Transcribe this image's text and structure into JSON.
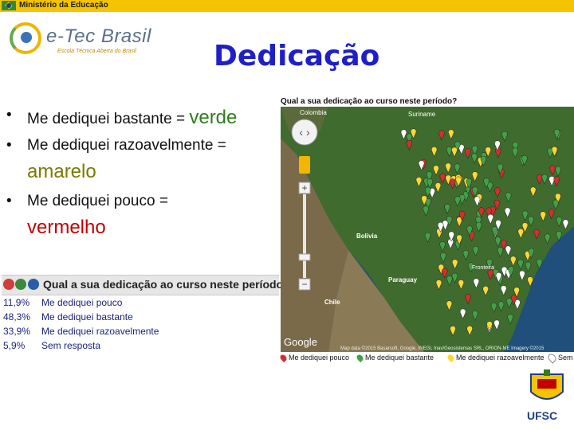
{
  "header": {
    "ministry": "Ministério da Educação"
  },
  "logo": {
    "name": "e-Tec Brasil",
    "tagline": "Escola Técnica Aberta do Brasil"
  },
  "slide": {
    "title": "Dedicação"
  },
  "bullets": {
    "b1_text": "Me dediquei bastante = ",
    "b1_value": "verde",
    "b2_text": "Me dediquei razoavelmente = ",
    "b2_value": "amarelo",
    "b3_text": "Me dediquei pouco = ",
    "b3_value": "vermelho"
  },
  "poll": {
    "title": "Qual a sua dedicação ao curso neste período?",
    "rows": [
      {
        "pct": "11,9%",
        "label": "Me dediquei pouco"
      },
      {
        "pct": "48,3%",
        "label": "Me dediquei bastante"
      },
      {
        "pct": "33,9%",
        "label": "Me dediquei razoavelmente"
      },
      {
        "pct": "5,9%",
        "label": "Sem resposta"
      }
    ]
  },
  "map": {
    "title": "Qual a sua dedicação ao curso neste período?",
    "labels": {
      "colombia": "Colombia",
      "suriname": "Suriname",
      "bolivia": "Bolivia",
      "paraguay": "Paraguay",
      "chile": "Chile",
      "fronteira": "Fronteira",
      "google": "Google",
      "attribution": "Map data ©2015 Basarsoft, Google, INEGI, Inav/Geosistemas SRL, ORION-ME Imagery ©2015"
    },
    "legend": [
      "Me dediquei pouco",
      "Me dediquei bastante",
      "Me dediquei razoavelmente",
      "Sem resposta"
    ]
  },
  "university": {
    "name": "UFSC"
  },
  "colors": {
    "green": "#2e7d1f",
    "yellow": "#7a7a00",
    "red": "#c00000",
    "title": "#1f1fc8"
  }
}
